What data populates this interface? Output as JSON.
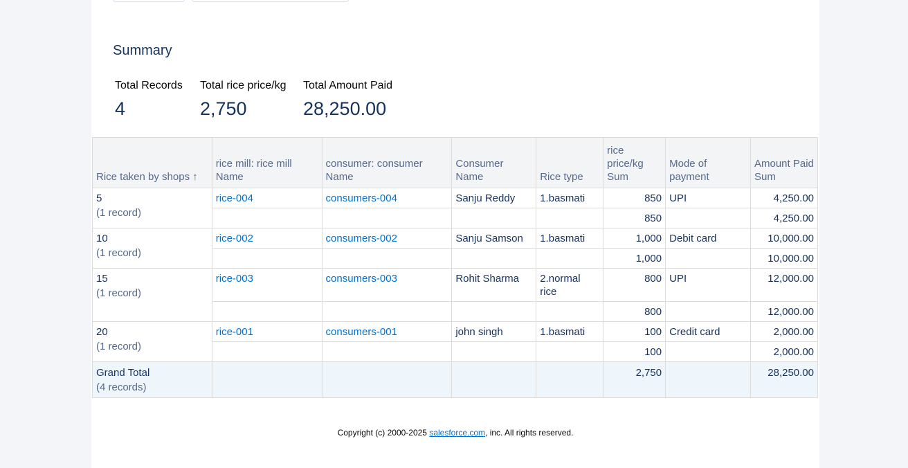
{
  "summary": {
    "title": "Summary",
    "metrics": [
      {
        "label": "Total Records",
        "value": "4"
      },
      {
        "label": "Total rice price/kg",
        "value": "2,750"
      },
      {
        "label": "Total Amount Paid",
        "value": "28,250.00"
      }
    ]
  },
  "table": {
    "headers": {
      "group": "Rice taken by shops",
      "sort_icon": "↑",
      "mill": "rice mill: rice mill Name",
      "consumer_ref": "consumer: consumer Name",
      "consumer_name": "Consumer Name",
      "rice_type": "Rice type",
      "price": "rice price/kg Sum",
      "payment": "Mode of payment",
      "amount": "Amount Paid Sum"
    },
    "groups": [
      {
        "key": "5",
        "count": "(1 record)",
        "mill": "rice-004",
        "consumer_ref": "consumers-004",
        "consumer_name": "Sanju Reddy",
        "rice_type": "1.basmati",
        "price": "850",
        "payment": "UPI",
        "amount": "4,250.00",
        "sub_price": "850",
        "sub_amount": "4,250.00"
      },
      {
        "key": "10",
        "count": "(1 record)",
        "mill": "rice-002",
        "consumer_ref": "consumers-002",
        "consumer_name": "Sanju Samson",
        "rice_type": "1.basmati",
        "price": "1,000",
        "payment": "Debit card",
        "amount": "10,000.00",
        "sub_price": "1,000",
        "sub_amount": "10,000.00"
      },
      {
        "key": "15",
        "count": "(1 record)",
        "mill": "rice-003",
        "consumer_ref": "consumers-003",
        "consumer_name": "Rohit Sharma",
        "rice_type": "2.normal rice",
        "price": "800",
        "payment": "UPI",
        "amount": "12,000.00",
        "sub_price": "800",
        "sub_amount": "12,000.00"
      },
      {
        "key": "20",
        "count": "(1 record)",
        "mill": "rice-001",
        "consumer_ref": "consumers-001",
        "consumer_name": "john singh",
        "rice_type": "1.basmati",
        "price": "100",
        "payment": "Credit card",
        "amount": "2,000.00",
        "sub_price": "100",
        "sub_amount": "2,000.00"
      }
    ],
    "grand_total": {
      "label": "Grand Total",
      "count": "(4 records)",
      "price": "2,750",
      "amount": "28,250.00"
    }
  },
  "footer": {
    "prefix": "Copyright (c) 2000-2025 ",
    "link": "salesforce.com",
    "suffix": ", inc. All rights reserved."
  },
  "colors": {
    "link": "#0070d2",
    "heading": "#16325c",
    "header_text": "#54698d"
  }
}
